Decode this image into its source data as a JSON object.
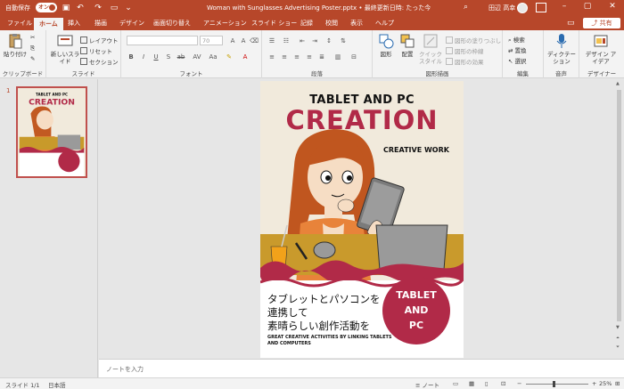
{
  "titlebar": {
    "autosave_label": "自動保存",
    "autosave_state": "オン",
    "doc_title": "Woman with Sunglasses Advertising Poster.pptx • 最終更新日時: たった今",
    "user_name": "田辺 高幸"
  },
  "tabs": [
    "ファイル",
    "ホーム",
    "挿入",
    "描画",
    "デザイン",
    "画面切り替え",
    "アニメーション",
    "スライド ショー",
    "記録",
    "校閲",
    "表示",
    "ヘルプ"
  ],
  "active_tab": "ホーム",
  "share_label": "共有",
  "ribbon": {
    "clipboard": {
      "paste": "貼り付け",
      "label": "クリップボード"
    },
    "slides": {
      "new_slide": "新しいスライド",
      "layout": "レイアウト",
      "reset": "リセット",
      "section": "セクション",
      "label": "スライド"
    },
    "font": {
      "size": "70",
      "label": "フォント"
    },
    "paragraph": {
      "label": "段落"
    },
    "drawing": {
      "shape": "図形",
      "arrange": "配置",
      "quick_style": "クイックスタイル",
      "fill": "図形の塗りつぶし",
      "outline": "図形の枠線",
      "effects": "図形の効果",
      "label": "図形描画"
    },
    "editing": {
      "find": "検索",
      "replace": "置換",
      "select": "選択",
      "label": "編集"
    },
    "voice": {
      "dictate": "ディクテーション",
      "label": "音声"
    },
    "designer": {
      "ideas": "デザイン アイデア",
      "label": "デザイナー"
    }
  },
  "thumbnail": {
    "number": "1"
  },
  "slide": {
    "title_line1": "TABLET AND PC",
    "title_line2": "CREATION",
    "tagline": "CREATIVE WORK",
    "jp_line1": "タブレットとパソコンを",
    "jp_line2": "連携して",
    "jp_line3": "素晴らしい創作活動を",
    "en_line1": "GREAT CREATIVE ACTIVITIES BY LINKING TABLETS",
    "en_line2": "AND COMPUTERS",
    "badge_line1": "TABLET",
    "badge_line2": "AND",
    "badge_line3": "PC"
  },
  "notes_placeholder": "ノートを入力",
  "statusbar": {
    "slide_count": "スライド 1/1",
    "language": "日本語",
    "notes_button": "ノート",
    "zoom": "25%"
  },
  "colors": {
    "accent": "#b7472a",
    "brand_red": "#b12a48",
    "slide_bg": "#f1eadc"
  }
}
